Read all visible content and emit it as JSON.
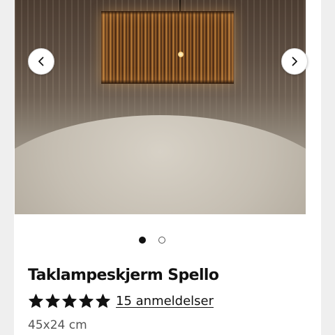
{
  "product": {
    "title": "Taklampeskjerm Spello",
    "review_count_label": "15 anmeldelser",
    "rating_stars": 5,
    "rating_max": 5,
    "size": "45x24 cm"
  },
  "gallery": {
    "image_count": 2,
    "active_index": 0,
    "prev_icon": "chevron-left-icon",
    "next_icon": "chevron-right-icon"
  },
  "colors": {
    "text_primary": "#111111",
    "text_secondary": "#555555",
    "page_background": "#efefef",
    "card_background": "#ffffff"
  }
}
